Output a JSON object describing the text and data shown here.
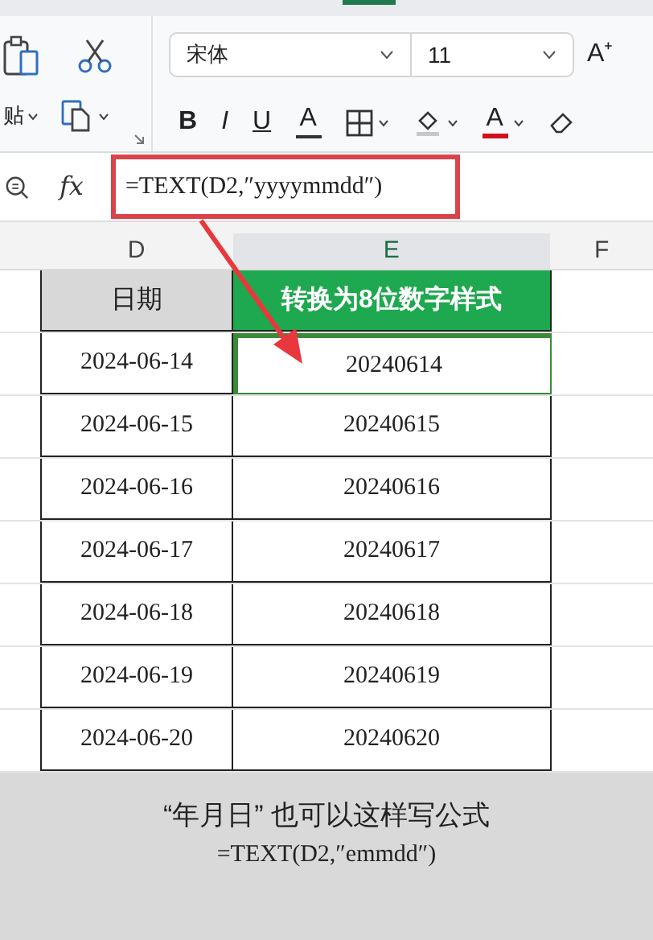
{
  "ribbon": {
    "paste_label": "贴",
    "font_name": "宋体",
    "font_size": "11",
    "grow_label": "A⁺",
    "buttons": [
      {
        "kind": "bold",
        "label": "B"
      },
      {
        "kind": "italic",
        "label": "I"
      },
      {
        "kind": "underline",
        "label": "U"
      },
      {
        "kind": "strike",
        "label": "A"
      },
      {
        "kind": "border"
      },
      {
        "kind": "fill"
      },
      {
        "kind": "fontcolor",
        "label": "A"
      },
      {
        "kind": "eraser"
      }
    ]
  },
  "formula_bar": {
    "function_label": "fx",
    "formula": "=TEXT(D2,″yyyymmdd″)"
  },
  "column_headers": [
    {
      "label": "D",
      "selected": false
    },
    {
      "label": "E",
      "selected": true
    },
    {
      "label": "F",
      "selected": false
    }
  ],
  "table": {
    "headers": [
      "日期",
      "转换为8位数字样式"
    ],
    "rows": [
      {
        "date": "2024-06-14",
        "number": "20240614",
        "selected": true
      },
      {
        "date": "2024-06-15",
        "number": "20240615",
        "selected": false
      },
      {
        "date": "2024-06-16",
        "number": "20240616",
        "selected": false
      },
      {
        "date": "2024-06-17",
        "number": "20240617",
        "selected": false
      },
      {
        "date": "2024-06-18",
        "number": "20240618",
        "selected": false
      },
      {
        "date": "2024-06-19",
        "number": "20240619",
        "selected": false
      },
      {
        "date": "2024-06-20",
        "number": "20240620",
        "selected": false
      }
    ]
  },
  "caption": [
    "“年月日” 也可以这样写公式",
    "=TEXT(D2,″emmdd″)"
  ]
}
